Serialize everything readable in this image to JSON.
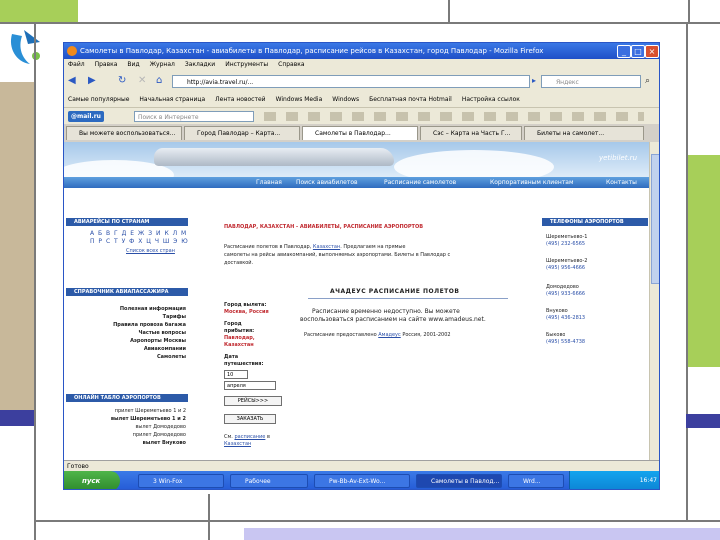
{
  "browser": {
    "title": "Самолеты в Павлодар, Казахстан - авиабилеты в Павлодар, расписание рейсов в Казахстан, город Павлодар - Mozilla Firefox",
    "menu": [
      "Файл",
      "Правка",
      "Вид",
      "Журнал",
      "Закладки",
      "Инструменты",
      "Справка"
    ],
    "url": "http://avia.travel.ru/...",
    "search_engine": "Яндекс",
    "bookmarks": [
      "Самые популярные",
      "Начальная страница",
      "Лента новостей",
      "Windows Media",
      "Windows",
      "Бесплатная почта Hotmail",
      "Настройка ссылок"
    ],
    "mail_logo": "@mail.ru",
    "mail_search": "Поиск в Интернете",
    "tabs": [
      "Вы можете воспользоваться...",
      "Город Павлодар – Карта...",
      "Самолеты в Павлодар...",
      "Сэс – Карта на Часть Г...",
      "Билеты на самолет..."
    ],
    "status": "Готово"
  },
  "site": {
    "domain": "yetibilet.ru",
    "nav": [
      "Главная",
      "Поиск авиабилетов",
      "Расписание самолетов",
      "Корпоративным клиентам",
      "Контакты"
    ],
    "left": {
      "sec1": "АВИАРЕЙСЫ ПО СТРАНАМ",
      "alphabet1": "А Б В Г Д Е Ж З И К Л М Н О",
      "alphabet2": "П Р С Т У Ф Х Ц Ч Ш Э Ю Я",
      "all_countries": "Список всех стран",
      "sec2": "СПРАВОЧНИК АВИАПАССАЖИРА",
      "links": [
        "Полезная информация",
        "Тарифы",
        "Правила провоза багажа",
        "Частые вопросы",
        "Аэропорты Москвы",
        "Авиакомпании",
        "Самолеты"
      ],
      "sec3": "ОНЛАЙН ТАБЛО АЭРОПОРТОВ",
      "tablo": [
        "прилет Шереметьево 1 и 2",
        "вылет Шереметьево 1 и 2",
        "вылет Домодедово",
        "прилет Домодедово",
        "вылет Внуково"
      ]
    },
    "center": {
      "heading": "ПАВЛОДАР, КАЗАХСТАН - АВИАБИЛЕТЫ, РАСПИСАНИЕ АЭРОПОРТОВ",
      "intro_l1_a": "Расписание полетов в Павлодар,",
      "intro_link": "Казахстан",
      "intro_l1_b": ". Предлагаем на прямые",
      "intro_l2": "самолеты на рейсы авиакомпаний, выполняемых аэропортами. Билеты в Павлодар с",
      "intro_l3": "доставкой.",
      "form": {
        "from_label": "Город вылета:",
        "from_value": "Москва, Россия",
        "to_label1": "Город",
        "to_label2": "прибытия:",
        "to_value1": "Павлодар,",
        "to_value2": "Казахстан",
        "date_label1": "Дата",
        "date_label2": "путешествия:",
        "day": "10",
        "month": "апреля",
        "search_btn": "РЕЙСЫ>>>",
        "order_btn": "ЗАКАЗАТЬ",
        "note_a": "См.",
        "note_link": "расписание",
        "note_b": "в",
        "note_c": "Казахстан"
      },
      "sched_title": "АЧАДЕУС    РАСПИСАНИЕ ПОЛЕТОВ",
      "sched_l1": "Расписание временно недоступно. Вы можете",
      "sched_l2": "воспользоваться расписанием на сайте www.amadeus.net.",
      "sched_foot_a": "Расписание предоставлено",
      "sched_foot_link": "Амадеус",
      "sched_foot_b": "Россия, 2001-2002"
    },
    "right": {
      "sec": "ТЕЛЕФОНЫ АЭРОПОРТОВ",
      "airports": [
        {
          "name": "Шереметьево-1",
          "phone": "(495) 232-6565"
        },
        {
          "name": "Шереметьево-2",
          "phone": "(495) 956-4666"
        },
        {
          "name": "Домодедово",
          "phone": "(495) 933-6666"
        },
        {
          "name": "Внуково",
          "phone": "(495) 436-2813"
        },
        {
          "name": "Быково",
          "phone": "(495) 558-4738"
        }
      ]
    }
  },
  "taskbar": {
    "start": "пуск",
    "items": [
      "3 Win-Fox",
      "Рабочее",
      "Pw-Bb-Av-Ext-Wo...",
      "Самолеты в Павлод...",
      "Wrd..."
    ],
    "clock": "16:47"
  }
}
